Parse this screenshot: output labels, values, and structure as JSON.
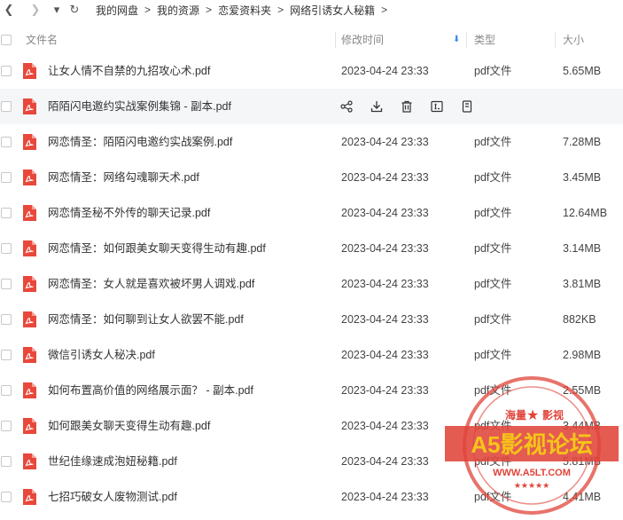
{
  "nav": {
    "back_glyph": "❮",
    "forward_glyph": "❯",
    "dropdown_glyph": "▾",
    "refresh_glyph": "↻",
    "breadcrumb": [
      "我的网盘",
      "我的资源",
      "恋爱资料夹",
      "网络引诱女人秘籍"
    ],
    "separator": ">"
  },
  "columns": {
    "name": "文件名",
    "modified": "修改时间",
    "type": "类型",
    "size": "大小",
    "sort_glyph": "⬇"
  },
  "files": [
    {
      "name": "让女人情不自禁的九招攻心术.pdf",
      "date": "2023-04-24 23:33",
      "type": "pdf文件",
      "size": "5.65MB"
    },
    {
      "name": "陌陌闪电邀约实战案例集锦 - 副本.pdf",
      "date": "",
      "type": "",
      "size": "",
      "hover": true
    },
    {
      "name": "网恋情圣：陌陌闪电邀约实战案例.pdf",
      "date": "2023-04-24 23:33",
      "type": "pdf文件",
      "size": "7.28MB"
    },
    {
      "name": "网恋情圣：网络勾魂聊天术.pdf",
      "date": "2023-04-24 23:33",
      "type": "pdf文件",
      "size": "3.45MB"
    },
    {
      "name": "网恋情圣秘不外传的聊天记录.pdf",
      "date": "2023-04-24 23:33",
      "type": "pdf文件",
      "size": "12.64MB"
    },
    {
      "name": "网恋情圣：如何跟美女聊天变得生动有趣.pdf",
      "date": "2023-04-24 23:33",
      "type": "pdf文件",
      "size": "3.14MB"
    },
    {
      "name": "网恋情圣：女人就是喜欢被坏男人调戏.pdf",
      "date": "2023-04-24 23:33",
      "type": "pdf文件",
      "size": "3.81MB"
    },
    {
      "name": "网恋情圣：如何聊到让女人欲罢不能.pdf",
      "date": "2023-04-24 23:33",
      "type": "pdf文件",
      "size": "882KB"
    },
    {
      "name": "微信引诱女人秘决.pdf",
      "date": "2023-04-24 23:33",
      "type": "pdf文件",
      "size": "2.98MB"
    },
    {
      "name": "如何布置高价值的网络展示面？ - 副本.pdf",
      "date": "2023-04-24 23:33",
      "type": "pdf文件",
      "size": "2.55MB"
    },
    {
      "name": "如何跟美女聊天变得生动有趣.pdf",
      "date": "2023-04-24 23:33",
      "type": "pdf文件",
      "size": "3.44MB"
    },
    {
      "name": "世纪佳缘速成泡妞秘籍.pdf",
      "date": "2023-04-24 23:33",
      "type": "pdf文件",
      "size": "5.81MB"
    },
    {
      "name": "七招巧破女人废物测试.pdf",
      "date": "2023-04-24 23:33",
      "type": "pdf文件",
      "size": "4.41MB"
    }
  ],
  "hover_actions": [
    "share-icon",
    "download-icon",
    "delete-icon",
    "rename-icon",
    "more-icon"
  ],
  "watermark": {
    "top_text": "海量",
    "top_text_right": "影视",
    "main_text": "A5影视论坛",
    "url": "WWW.A5LT.COM",
    "color": "#e0443a",
    "accent": "#f5c518"
  },
  "colors": {
    "pdf_icon": "#e8483b",
    "sort_accent": "#3a8ee6",
    "hover_bg": "#f5f6f8"
  }
}
